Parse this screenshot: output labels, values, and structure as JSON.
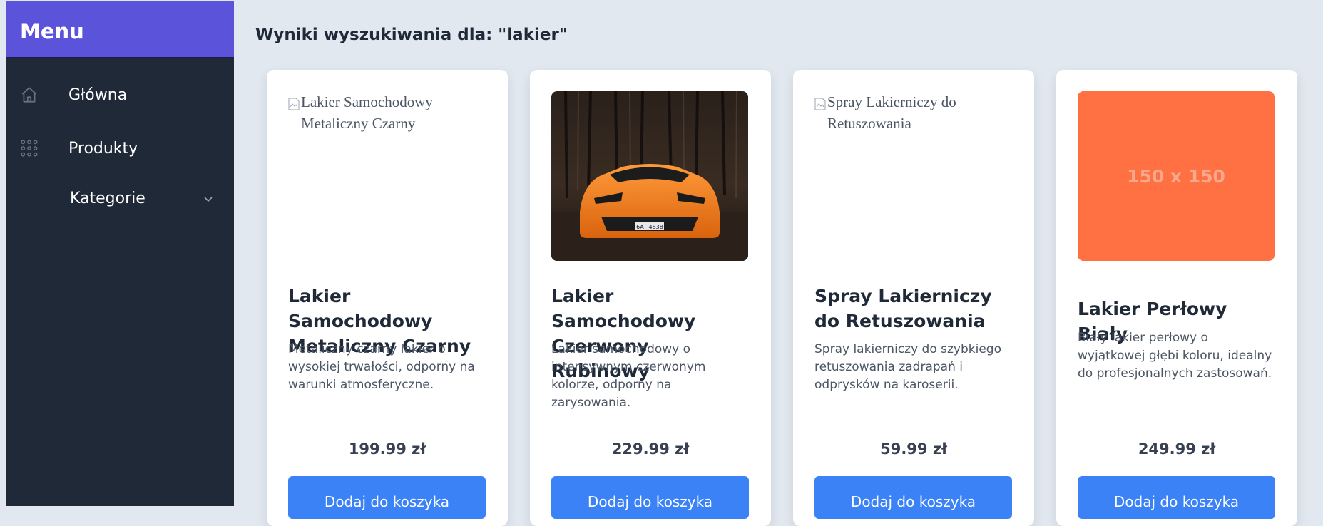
{
  "sidebar": {
    "title": "Menu",
    "items": [
      {
        "label": "Główna",
        "icon": "home-icon"
      },
      {
        "label": "Produkty",
        "icon": "grid-icon"
      },
      {
        "label": "Kategorie",
        "icon": "chevron-down-icon"
      }
    ]
  },
  "main": {
    "title": "Wyniki wyszukiwania dla: \"lakier\""
  },
  "products": [
    {
      "name": "Lakier Samochodowy Metaliczny Czarny",
      "alt": "Lakier Samochodowy Metaliczny Czarny",
      "description": "Metaliczny czarny lakier o wysokiej trwałości, odporny na warunki atmosferyczne.",
      "price": "199.99 zł",
      "button": "Dodaj do koszyka",
      "image": "broken"
    },
    {
      "name": "Lakier Samochodowy Czerwony Rubinowy",
      "alt": "",
      "description": "Lakier samochodowy o intensywnym czerwonym kolorze, odporny na zarysowania.",
      "price": "229.99 zł",
      "button": "Dodaj do koszyka",
      "image": "photo-orange-sports-car",
      "plate": "6AT 4838"
    },
    {
      "name": "Spray Lakierniczy do Retuszowania",
      "alt": "Spray Lakierniczy do Retuszowania",
      "description": "Spray lakierniczy do szybkiego retuszowania zadrapań i odprysków na karoserii.",
      "price": "59.99 zł",
      "button": "Dodaj do koszyka",
      "image": "broken"
    },
    {
      "name": "Lakier Perłowy Biały",
      "alt": "",
      "description": "Biały lakier perłowy o wyjątkowej głębi koloru, idealny do profesjonalnych zastosowań.",
      "price": "249.99 zł",
      "button": "Dodaj do koszyka",
      "image": "placeholder",
      "placeholder_text": "150 x 150"
    }
  ],
  "colors": {
    "menu_header": "#5b54db",
    "sidebar_bg": "#1f2937",
    "page_bg": "#e2e8f0",
    "button": "#3b82f6",
    "placeholder": "#ff7043"
  }
}
